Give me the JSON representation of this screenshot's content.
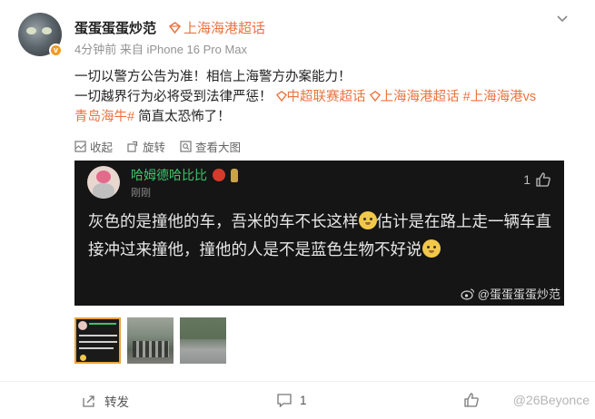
{
  "post": {
    "username": "蛋蛋蛋蛋炒范",
    "topic_header": "上海海港超话",
    "meta": "4分钟前  来自 iPhone 16 Pro Max",
    "content_line1": "一切以警方公告为准！相信上海警方办案能力！",
    "content_line2_a": "一切越界行为必将受到法律严惩！",
    "tag1": "中超联赛超话",
    "tag2": "上海海港超话",
    "tag3": "#上海海港vs",
    "tag3_cont": "青岛海牛#",
    "content_end": " 简直太恐怖了！",
    "icons": {
      "more": "chevron-down-icon",
      "verified": "v-badge-icon",
      "topic": "diamond-icon"
    }
  },
  "toolbar": {
    "collect": "收起",
    "rotate": "旋转",
    "view_large": "查看大图"
  },
  "card": {
    "name": "哈姆德哈比比",
    "time": "刚刚",
    "likes": "1",
    "text_1": "灰色的是撞他的车，吾米的车不长这样",
    "text_2": "估计是在路上走一辆车直接冲过来撞他，撞他的人是不是蓝色生物不好说",
    "watermark": "@蛋蛋蛋蛋炒范"
  },
  "actions": {
    "repost": "转发",
    "comment_count": "1",
    "watermark": "@26Beyonce"
  },
  "colors": {
    "accent": "#eb7340",
    "green_name": "#3bc46a",
    "card_bg": "#151515"
  }
}
